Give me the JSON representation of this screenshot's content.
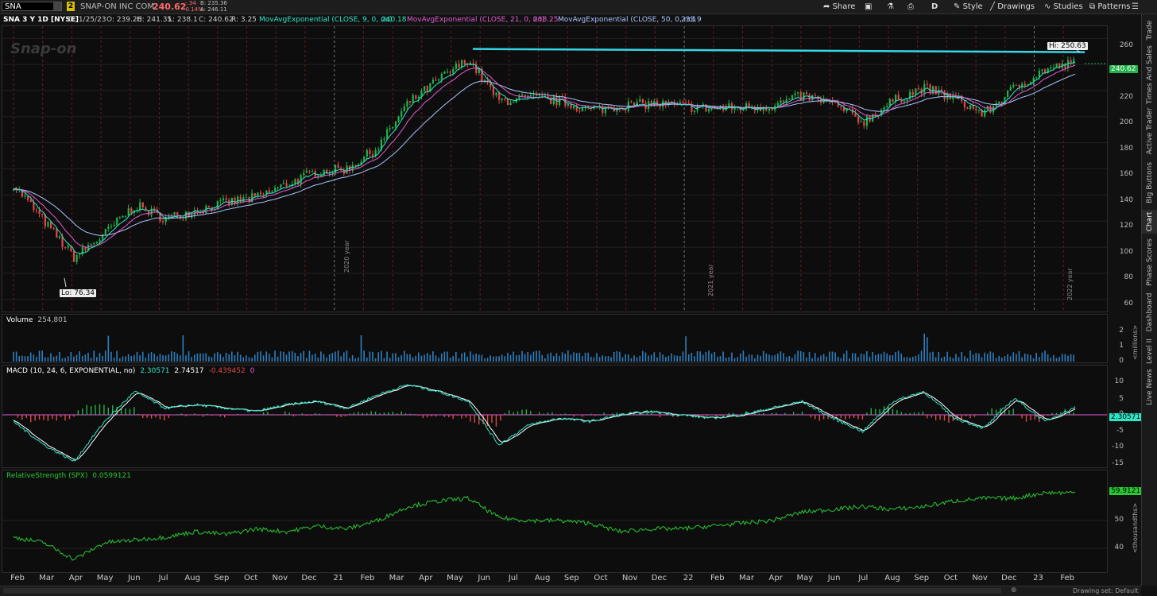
{
  "toolbar": {
    "symbol": "SNA",
    "link_badge": "2",
    "company": "SNAP-ON INC COM",
    "last": "240.62",
    "change": "-.34",
    "change_pct": "-0.14%",
    "bid": "B: 235.36",
    "ask": "A: 246.11",
    "buttons": {
      "share": "Share",
      "interval": "D",
      "style": "Style",
      "drawings": "Drawings",
      "studies": "Studies",
      "patterns": "Patterns"
    }
  },
  "header": {
    "title": "SNA 3 Y 1D [NYSE]",
    "ohlc": [
      "D: 1/25/23",
      "O: 239.26",
      "H: 241.35",
      "L: 238.1",
      "C: 240.62",
      "R: 3.25"
    ],
    "ema9_label": "MovAvgExponential (CLOSE, 9, 0, no)",
    "ema9_value": "240.18",
    "ema21_label": "MovAvgExponential (CLOSE, 21, 0, no)",
    "ema21_value": "238.25",
    "ema50_label": "MovAvgExponential (CLOSE, 50, 0, no)",
    "ema50_value": "233.9"
  },
  "watermark": "Snap-on",
  "price": {
    "hi_label": "Hi: 250.63",
    "lo_label": "Lo: 76.34",
    "last_tag": "240.62",
    "ticks": [
      "260",
      "240",
      "220",
      "200",
      "180",
      "160",
      "140",
      "120",
      "100",
      "80",
      "60"
    ],
    "year_labels": [
      "2020 year",
      "2021 year",
      "2022 year"
    ]
  },
  "volume": {
    "label": "Volume",
    "value": "254,801",
    "ticks": [
      "2",
      "1",
      "0"
    ],
    "unit": "<millions>"
  },
  "macd": {
    "label": "MACD (10, 24, 6, EXPONENTIAL, no)",
    "v1": "2.30571",
    "v2": "2.74517",
    "v3": "-0.439452",
    "v4": "0",
    "tag": "2.30571",
    "ticks": [
      "10",
      "5",
      "0",
      "-5",
      "-10",
      "-15"
    ]
  },
  "rs": {
    "label": "RelativeStrength (SPX)",
    "value": "0.0599121",
    "tag": "59.9121",
    "ticks": [
      "50",
      "40"
    ],
    "unit": "<thousandths>"
  },
  "xaxis": [
    "Feb",
    "Mar",
    "Apr",
    "May",
    "Jun",
    "Jul",
    "Aug",
    "Sep",
    "Oct",
    "Nov",
    "Dec",
    "21",
    "Feb",
    "Mar",
    "Apr",
    "May",
    "Jun",
    "Jul",
    "Aug",
    "Sep",
    "Oct",
    "Nov",
    "Dec",
    "22",
    "Feb",
    "Mar",
    "Apr",
    "May",
    "Jun",
    "Jul",
    "Aug",
    "Sep",
    "Oct",
    "Nov",
    "Dec",
    "23",
    "Feb"
  ],
  "sidebar": [
    "Trade",
    "Times And Sales",
    "Active Trader",
    "Big Buttons",
    "Chart",
    "Phase Scores",
    "Dashboard",
    "Level II",
    "Live News"
  ],
  "status": "Drawing set: Default",
  "colors": {
    "up": "#22b34a",
    "down": "#e04848",
    "ema9": "#2ee6c6",
    "ema21": "#e45bd6",
    "ema50": "#a9c4ff",
    "resistance": "#36d6e8",
    "volume": "#2f7fbf",
    "rs": "#28c832",
    "accent": "#d6c000"
  },
  "chart_data": {
    "type": "candlestick",
    "x": [
      "Feb",
      "Mar",
      "Apr",
      "May",
      "Jun",
      "Jul",
      "Aug",
      "Sep",
      "Oct",
      "Nov",
      "Dec",
      "21",
      "Feb",
      "Mar",
      "Apr",
      "May",
      "Jun",
      "Jul",
      "Aug",
      "Sep",
      "Oct",
      "Nov",
      "Dec",
      "22",
      "Feb",
      "Mar",
      "Apr",
      "May",
      "Jun",
      "Jul",
      "Aug",
      "Sep",
      "Oct",
      "Nov",
      "Dec",
      "23"
    ],
    "close": [
      148,
      120,
      92,
      110,
      132,
      122,
      128,
      134,
      138,
      148,
      158,
      160,
      176,
      210,
      228,
      244,
      212,
      214,
      212,
      205,
      208,
      210,
      208,
      206,
      207,
      208,
      216,
      210,
      196,
      212,
      222,
      214,
      202,
      222,
      236,
      241
    ],
    "hi": 250.63,
    "lo": 76.34,
    "last": 240.62,
    "ylim": [
      55,
      265
    ],
    "series": [
      {
        "name": "MovAvgExponential (CLOSE, 9, 0, no)"
      },
      {
        "name": "MovAvgExponential (CLOSE, 21, 0, no)"
      },
      {
        "name": "MovAvgExponential (CLOSE, 50, 0, no)"
      }
    ],
    "macd": [
      -2,
      -9,
      -14,
      -2,
      7,
      2,
      3,
      2,
      1,
      3,
      4,
      2,
      6,
      9,
      7,
      4,
      -9,
      -3,
      -1,
      -2,
      0,
      1,
      0,
      -1,
      0,
      2,
      4,
      -1,
      -5,
      4,
      7,
      -1,
      -4,
      5,
      -2,
      2.3
    ],
    "rs": [
      44,
      42,
      36,
      42,
      43,
      44,
      46,
      45,
      47,
      46,
      48,
      47,
      50,
      55,
      57,
      58,
      51,
      50,
      50,
      49,
      46,
      47,
      47,
      48,
      49,
      50,
      53,
      54,
      55,
      54,
      55,
      57,
      58,
      58,
      60,
      60
    ]
  }
}
